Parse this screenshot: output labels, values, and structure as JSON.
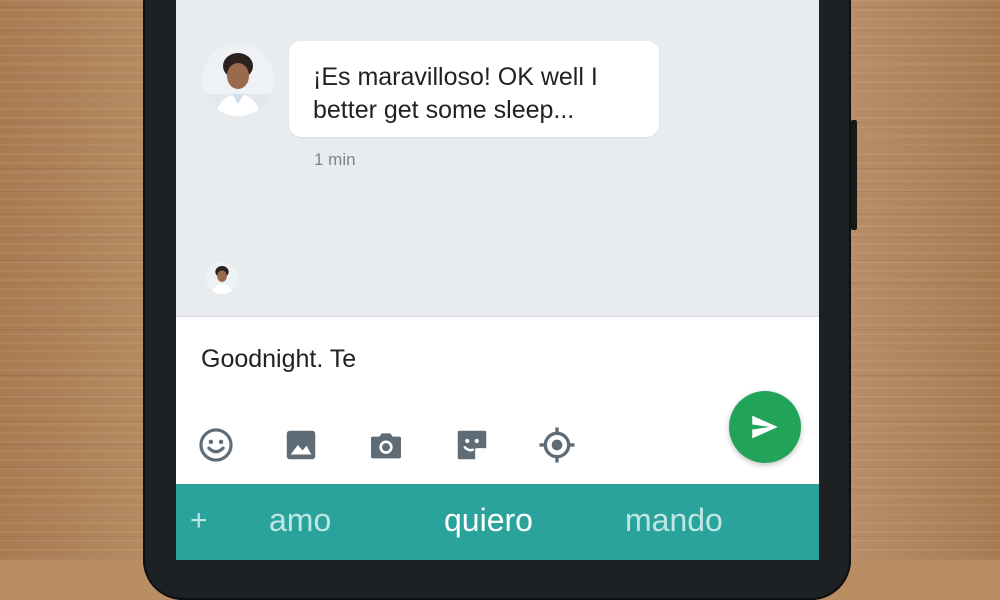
{
  "conversation": {
    "message": {
      "text_line1": "¡Es maravilloso! OK well I",
      "text_line2": "better get some sleep...",
      "time": "1 min"
    }
  },
  "composer": {
    "input_value": "Goodnight. Te",
    "tools": [
      "emoji-icon",
      "image-icon",
      "camera-icon",
      "sticker-icon",
      "location-icon"
    ],
    "send_icon": "send-icon"
  },
  "suggestions": {
    "plus": "+",
    "words": [
      "amo",
      "quiero",
      "mando"
    ]
  },
  "colors": {
    "accent_send": "#22a35a",
    "suggestion_bar": "#2aa39c",
    "tool_icon": "#5f6b75"
  }
}
